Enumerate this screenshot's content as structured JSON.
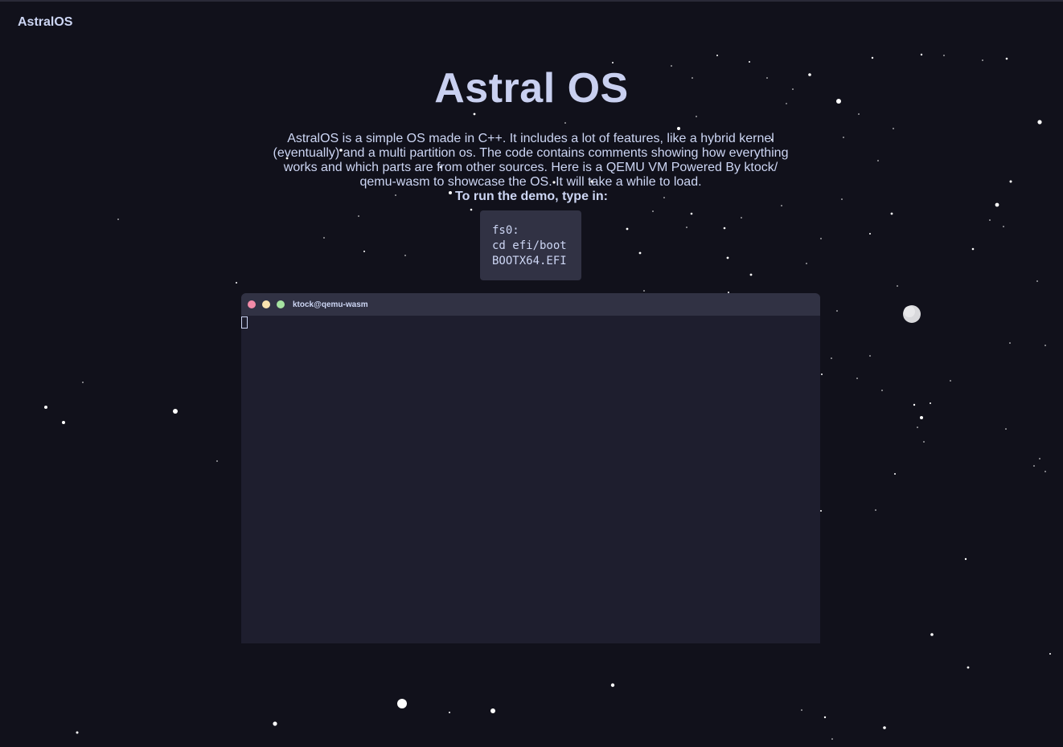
{
  "brand": "AstralOS",
  "hero": {
    "title": "Astral OS",
    "description": "AstralOS is a simple OS made in C++. It includes a lot of features, like a hybrid kernel (eventually) and a multi partition os. The code contains comments showing how everything works and which parts are from other sources. Here is a QEMU VM Powered By ktock/ qemu-wasm to showcase the OS. It will take a while to load.",
    "demo_label": "To run the demo, type in:"
  },
  "code": {
    "lines": [
      "fs0:",
      "cd efi/boot",
      "BOOTX64.EFI"
    ]
  },
  "terminal": {
    "title": "ktock@qemu-wasm",
    "buttons": {
      "close_color": "#f38ba8",
      "minimize_color": "#f9e2af",
      "maximize_color": "#a6e3a1"
    }
  },
  "colors": {
    "background": "#11111b",
    "text": "#cdd6f4",
    "panel": "#313244",
    "terminal_bg": "#1e1e2e"
  }
}
